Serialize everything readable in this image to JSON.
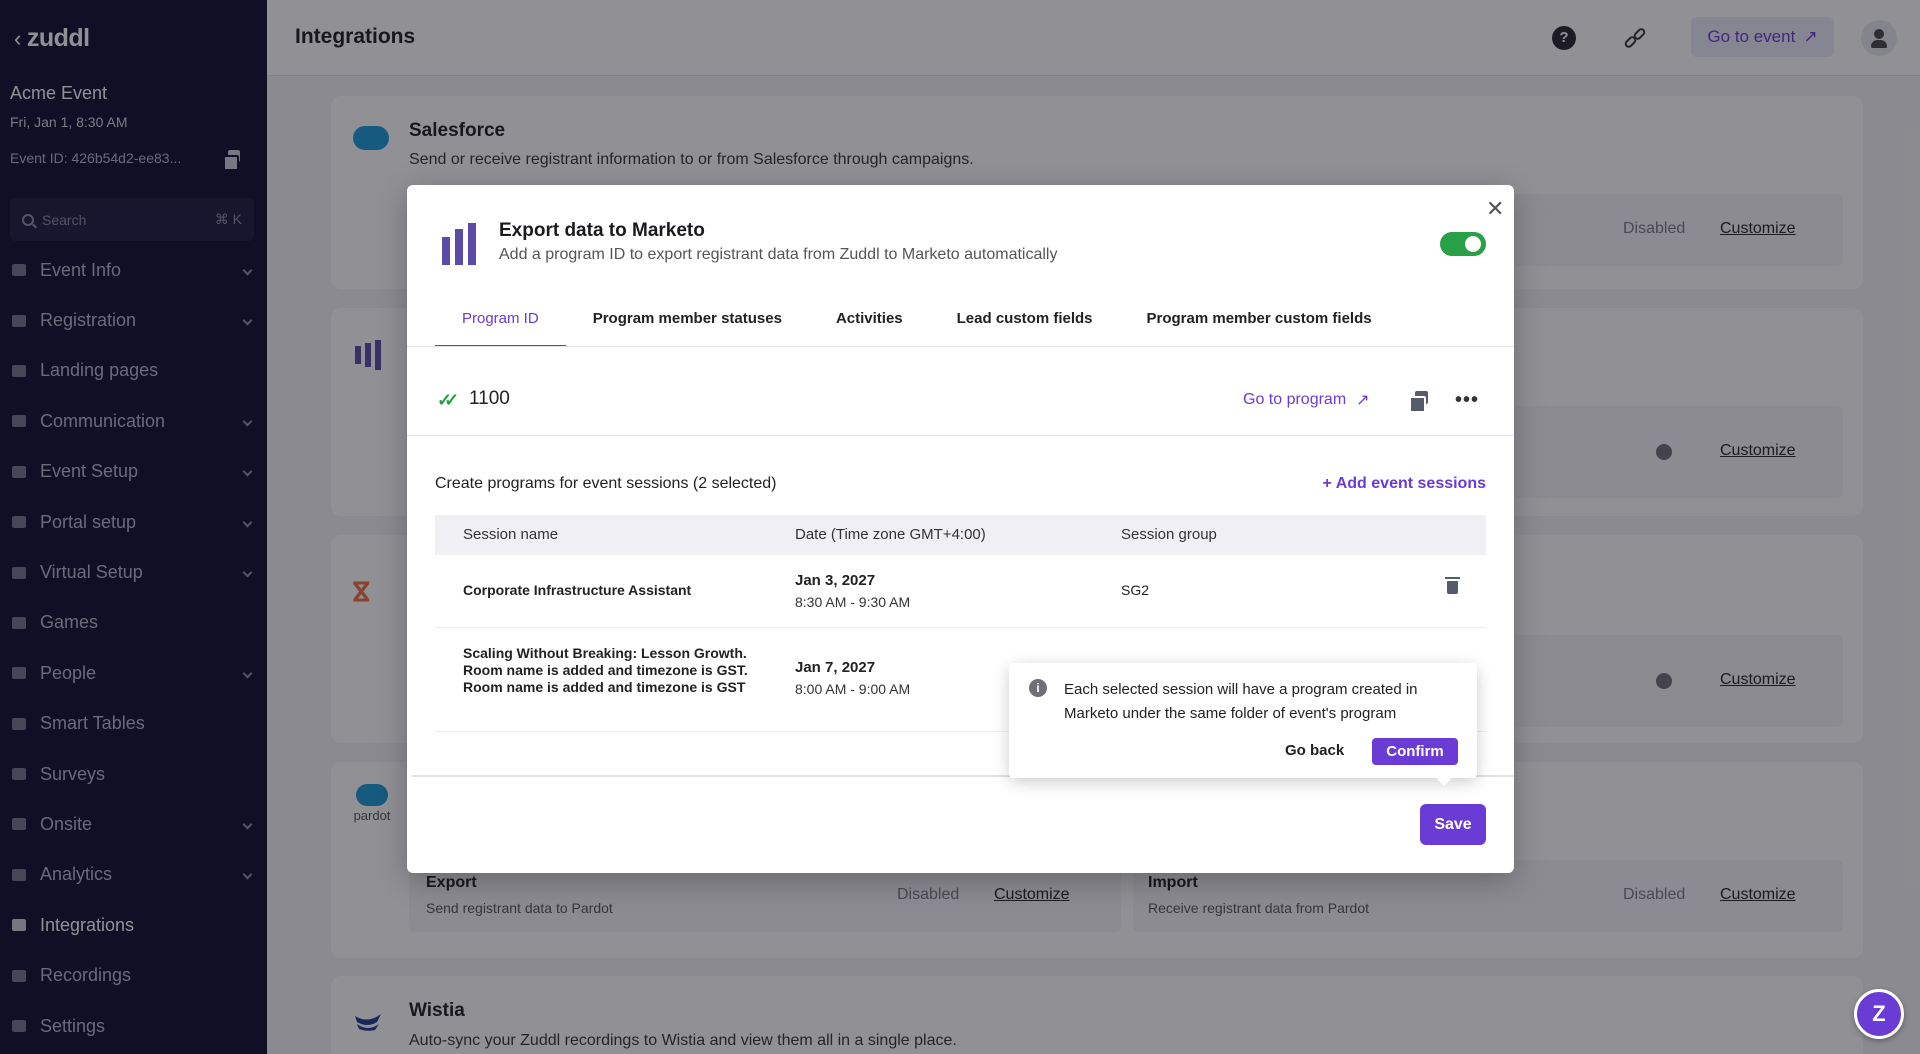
{
  "sidebar": {
    "logo": "zuddl",
    "event_name": "Acme Event",
    "event_date": "Fri, Jan 1, 8:30 AM",
    "event_id": "Event ID: 426b54d2-ee83...",
    "search_placeholder": "Search",
    "search_shortcut": "⌘ K",
    "items": [
      {
        "label": "Event Info",
        "icon": "edit-icon",
        "expandable": true
      },
      {
        "label": "Registration",
        "icon": "form-icon",
        "expandable": true
      },
      {
        "label": "Landing pages",
        "icon": "page-icon",
        "expandable": false
      },
      {
        "label": "Communication",
        "icon": "mail-icon",
        "expandable": true
      },
      {
        "label": "Event Setup",
        "icon": "setup-icon",
        "expandable": true
      },
      {
        "label": "Portal setup",
        "icon": "person-icon",
        "expandable": true
      },
      {
        "label": "Virtual Setup",
        "icon": "person-icon",
        "expandable": true
      },
      {
        "label": "Games",
        "icon": "trophy-icon",
        "expandable": false
      },
      {
        "label": "People",
        "icon": "people-icon",
        "expandable": true
      },
      {
        "label": "Smart Tables",
        "icon": "table-icon",
        "expandable": false
      },
      {
        "label": "Surveys",
        "icon": "survey-icon",
        "expandable": false
      },
      {
        "label": "Onsite",
        "icon": "onsite-icon",
        "expandable": true
      },
      {
        "label": "Analytics",
        "icon": "chart-icon",
        "expandable": true
      },
      {
        "label": "Integrations",
        "icon": "link-icon",
        "expandable": false,
        "active": true
      },
      {
        "label": "Recordings",
        "icon": "record-icon",
        "expandable": false
      },
      {
        "label": "Settings",
        "icon": "gear-icon",
        "expandable": false
      }
    ]
  },
  "header": {
    "title": "Integrations",
    "go_to_event": "Go to event"
  },
  "cards": {
    "salesforce": {
      "title": "Salesforce",
      "desc": "Send or receive registrant information to or from Salesforce through campaigns.",
      "status": "Disabled",
      "customize": "Customize"
    },
    "marketo": {
      "customize": "Customize"
    },
    "hubspot": {
      "customize": "Customize"
    },
    "pardot": {
      "logo_text": "pardot",
      "export_title": "Export",
      "export_desc": "Send registrant data to Pardot",
      "import_title": "Import",
      "import_desc": "Receive registrant data from Pardot",
      "status": "Disabled",
      "customize": "Customize"
    },
    "wistia": {
      "title": "Wistia",
      "desc": "Auto-sync your Zuddl recordings to Wistia and view them all in a single place."
    }
  },
  "modal": {
    "title": "Export data to Marketo",
    "subtitle": "Add a program ID to export registrant data from Zuddl to Marketo automatically",
    "toggle_on": true,
    "tabs": [
      "Program ID",
      "Program member statuses",
      "Activities",
      "Lead custom fields",
      "Program member custom fields"
    ],
    "active_tab": "Program ID",
    "program_id": "1100",
    "go_to_program": "Go to program",
    "sessions_title": "Create programs for event sessions (2 selected)",
    "add_sessions": "+ Add event sessions",
    "table": {
      "headers": [
        "Session name",
        "Date (Time zone GMT+4:00)",
        "Session group"
      ],
      "rows": [
        {
          "name": "Corporate Infrastructure Assistant",
          "date": "Jan 3, 2027",
          "time": "8:30 AM - 9:30 AM",
          "group": "SG2"
        },
        {
          "name": "Scaling Without Breaking: Lesson Growth. Room name is added and timezone is GST. Room name is added and timezone is GST",
          "date": "Jan 7, 2027",
          "time": "8:00 AM - 9:00 AM",
          "group": ""
        }
      ]
    },
    "save": "Save"
  },
  "popover": {
    "text": "Each selected session will have a program created in Marketo under the same folder of event's program",
    "go_back": "Go back",
    "confirm": "Confirm"
  },
  "colors": {
    "accent": "#6b3bd6",
    "sidebar_bg": "#0f0d2e",
    "toggle_on": "#27a048"
  }
}
